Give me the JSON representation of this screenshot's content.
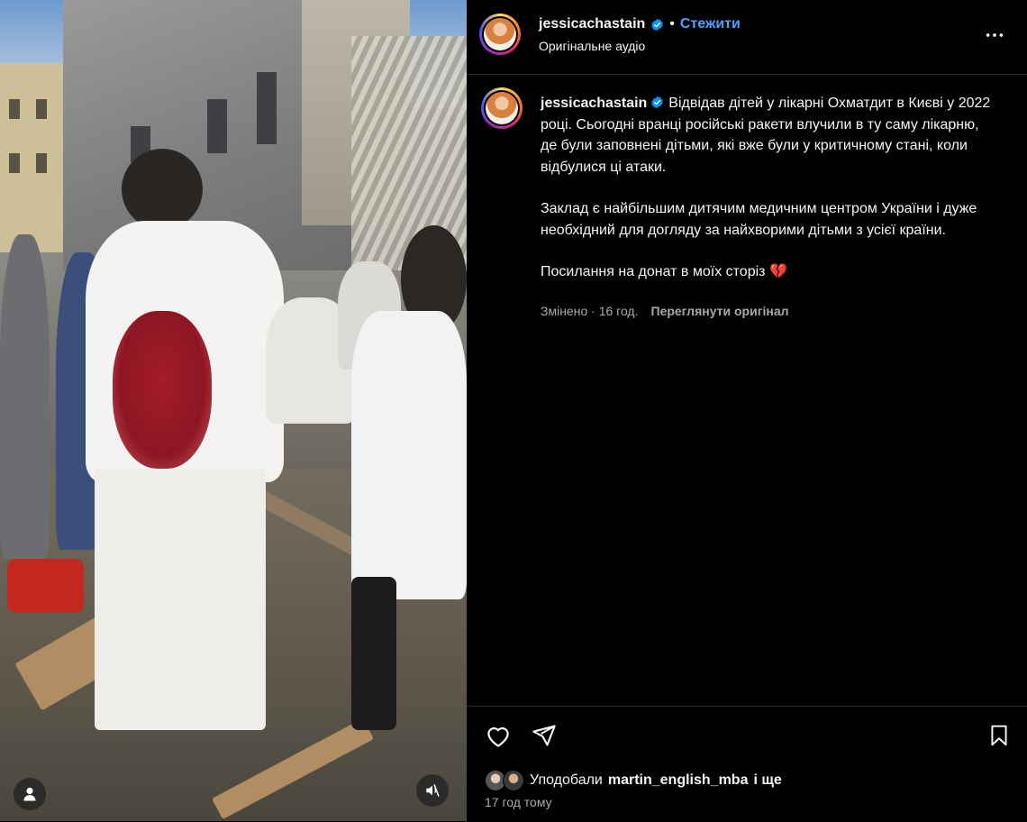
{
  "post": {
    "username": "jessicachastain",
    "follow_label": "Стежити",
    "audio_label": "Оригінальне аудіо",
    "caption_paragraphs": [
      "Відвідав дітей у лікарні Охматдит в Києві у 2022 році. Сьогодні вранці російські ракети влучили в ту саму лікарню, де були заповнені дітьми, які вже були у критичному стані, коли відбулися ці атаки.",
      "Заклад є найбільшим дитячим медичним центром України і дуже необхідний для догляду за найхворими дітьми з усієї країни.",
      "Посилання на донат в моїх сторіз 💔"
    ],
    "edited_label": "Змінено",
    "edited_time": "16 год.",
    "view_original_label": "Переглянути оригінал"
  },
  "likes": {
    "prefix": "Уподобали",
    "user": "martin_english_mba",
    "suffix": "і ще"
  },
  "posted_time": "17 год тому",
  "icons": {
    "verified": "verified-badge-icon",
    "more": "more-options-icon",
    "like": "heart-icon",
    "share": "send-icon",
    "save": "bookmark-icon",
    "tagged_users": "user-icon",
    "mute": "muted-speaker-icon"
  },
  "colors": {
    "background": "#000000",
    "text": "#f5f5f5",
    "secondary_text": "#a8a8a8",
    "link": "#4aa3ff",
    "verified": "#0095f6"
  }
}
